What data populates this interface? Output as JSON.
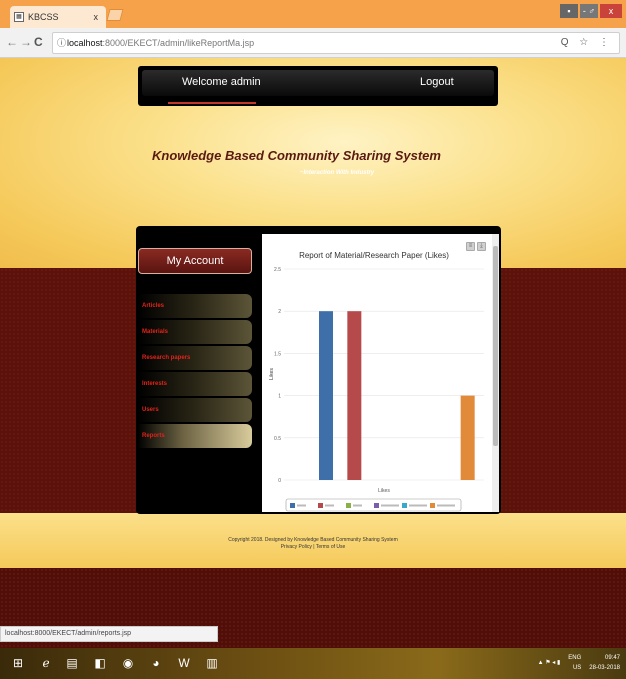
{
  "browser": {
    "tab_title": "KBCSS",
    "tab_close": "x",
    "url_host": "localhost",
    "url_path": ":8000/EKECT/admin/likeReportMa.jsp",
    "url_icon": "ⓘ",
    "url_right": "Q ☆ ⋮",
    "back": "←",
    "forward": "→",
    "reload": "C",
    "status_text": "localhost:8000/EKECT/admin/reports.jsp"
  },
  "window": {
    "minimize": "▪",
    "maximize": "- ♂",
    "close": "x"
  },
  "nav": {
    "welcome": "Welcome  admin",
    "logout": "Logout"
  },
  "header": {
    "title": "Knowledge Based Community Sharing System",
    "subtitle": "~Interaction With Industry"
  },
  "sidebar": {
    "my_account": "My Account",
    "items": [
      {
        "label": "Articles"
      },
      {
        "label": "Materials"
      },
      {
        "label": "Research papers"
      },
      {
        "label": "Interests"
      },
      {
        "label": "Users"
      },
      {
        "label": "Reports"
      }
    ]
  },
  "chart_tools": [
    "≡",
    "⤓"
  ],
  "chart_data": {
    "type": "bar",
    "title": "Report of Material/Research Paper (Likes)",
    "xlabel": "Likes",
    "ylabel": "Likes",
    "ylim": [
      0,
      2.5
    ],
    "yticks": [
      "0",
      "0.5",
      "1",
      "1.5",
      "2",
      "2.5"
    ],
    "categories": [
      ""
    ],
    "series": [
      {
        "name": "",
        "values": [
          2
        ],
        "color": "#3e6fa8"
      },
      {
        "name": "",
        "values": [
          2
        ],
        "color": "#b64a4a"
      },
      {
        "name": "",
        "values": [
          0
        ],
        "color": "#8ab04a"
      },
      {
        "name": "",
        "values": [
          0
        ],
        "color": "#7a5ea8"
      },
      {
        "name": "",
        "values": [
          0
        ],
        "color": "#3aa8c8"
      },
      {
        "name": "",
        "values": [
          1
        ],
        "color": "#e08a3a"
      }
    ]
  },
  "footer": {
    "line1": "Copyright 2018. Designed by Knowledge Based Community Sharing System",
    "line2": "Privacy Policy | Terms of Use"
  },
  "taskbar": {
    "lang": "ENG",
    "region": "US",
    "time": "09:47",
    "date": "28-03-2018"
  }
}
